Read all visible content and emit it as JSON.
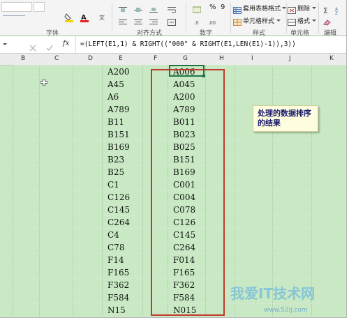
{
  "ribbon": {
    "font_color_name": "font-color",
    "percent_label": "%",
    "comma_label": "9",
    "cond_format_label": "套用表格格式",
    "cell_style_label": "单元格样式",
    "delete_label": "删除",
    "format_label": "格式",
    "groups": {
      "font": "字体",
      "alignment": "对齐方式",
      "number": "数字",
      "styles": "样式",
      "cells": "单元格",
      "editing": "编辑"
    }
  },
  "formula_bar": {
    "fx_label": "fx",
    "formula": "=(LEFT(E1,1) & RIGHT((\"000\" & RIGHT(E1,LEN(E1)-1)),3))"
  },
  "columns": [
    "B",
    "C",
    "D",
    "E",
    "F",
    "G",
    "H",
    "I",
    "J",
    "K"
  ],
  "column_e": [
    "A200",
    "A45",
    "A6",
    "A789",
    "B11",
    "B151",
    "B169",
    "B23",
    "B25",
    "C1",
    "C126",
    "C145",
    "C264",
    "C4",
    "C78",
    "F14",
    "F165",
    "F362",
    "F584",
    "N15"
  ],
  "column_g": [
    "A006",
    "A045",
    "A200",
    "A789",
    "B011",
    "B023",
    "B025",
    "B151",
    "B169",
    "C001",
    "C004",
    "C078",
    "C126",
    "C145",
    "C264",
    "F014",
    "F165",
    "F362",
    "F584",
    "N015"
  ],
  "note": {
    "text": "处理的数据排序的结果"
  },
  "watermark": {
    "text": "我爱IT技术网",
    "url": "www.52ij.com"
  },
  "colors": {
    "sheet_bg": "#c9e9c4",
    "highlight_box": "#c0392b",
    "note_bg": "#fffde0",
    "active_cell": "#217346"
  }
}
